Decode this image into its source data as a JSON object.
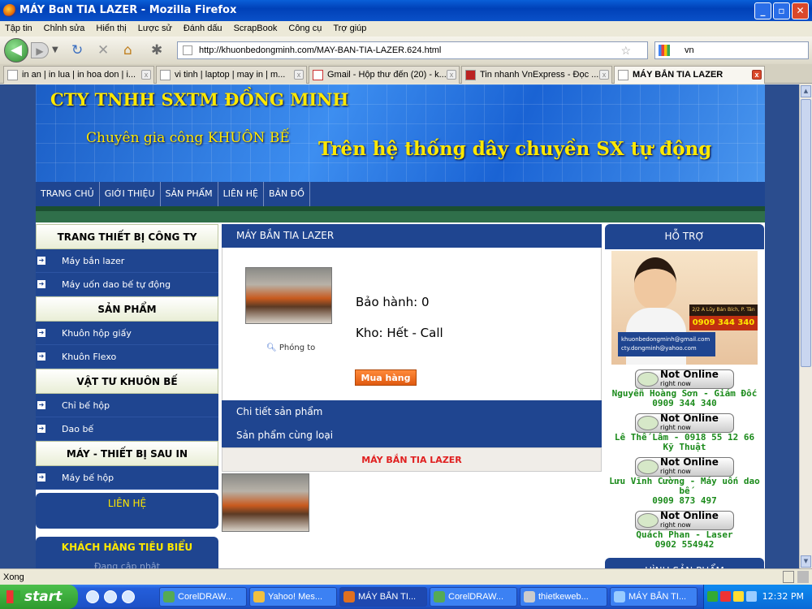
{
  "window": {
    "title": "MÁY BɑN TIA LAZER - Mozilla Firefox"
  },
  "menu": [
    "Tập tin",
    "Chỉnh sửa",
    "Hiển thị",
    "Lược sử",
    "Đánh dấu",
    "ScrapBook",
    "Công cụ",
    "Trợ giúp"
  ],
  "nav": {
    "url": "http://khuonbedongminh.com/MAY-BAN-TIA-LAZER.624.html",
    "search_value": "vn"
  },
  "tabs": [
    {
      "label": "in an | in lua | in hoa don | i..."
    },
    {
      "label": "vi tinh | laptop | may in | m..."
    },
    {
      "label": "Gmail - Hộp thư đến (20) - k..."
    },
    {
      "label": "Tin nhanh VnExpress - Đọc ..."
    },
    {
      "label": "MÁY BẮN TIA LAZER"
    }
  ],
  "banner": {
    "company": "CTY TNHH SXTM ĐỒNG MINH",
    "expert": "Chuyên gia công KHUÔN BẾ",
    "slogan": "Trên hệ thống dây  chuyền SX tự động"
  },
  "main_nav": [
    "TRANG CHỦ",
    "GIỚI THIỆU",
    "SẢN PHẨM",
    "LIÊN HỆ",
    "BẢN ĐỒ"
  ],
  "left": {
    "sections": [
      {
        "title": "TRANG THIẾT BỊ CÔNG TY",
        "items": [
          "Máy bắn lazer",
          "Máy uốn dao bế tự động"
        ]
      },
      {
        "title": "SẢN PHẨM",
        "items": [
          "Khuôn hộp giấy",
          "Khuôn Flexo"
        ]
      },
      {
        "title": "VẬT TƯ KHUÔN BẾ",
        "items": [
          "Chỉ bế hộp",
          "Dao bế"
        ]
      },
      {
        "title": "MÁY - THIẾT BỊ SAU IN",
        "items": [
          "Máy bế hộp"
        ]
      }
    ],
    "contact": "LIÊN HỆ",
    "customers": "KHÁCH HÀNG TIÊU BIỂU",
    "customers_sub": "Đang cập nhật"
  },
  "product": {
    "header": "MÁY BẮN TIA LAZER",
    "zoom": "Phóng to",
    "warranty": "Bảo hành: 0",
    "stock": "Kho: Hết - Call",
    "buy": "Mua hàng",
    "tab_detail": "Chi tiết sản phẩm",
    "tab_related": "Sản phẩm cùng loại",
    "related_title": "MÁY BẮN TIA LAZER"
  },
  "right": {
    "support_title": "HỖ TRỢ",
    "support_address": "2/2 A Lũy Bán Bích, P. Tân Thới Hòa, Q. Tân Phú, HCM",
    "support_phone": "0909 344 340",
    "support_email1": "khuonbedongminh@gmail.com",
    "support_email2": "cty.dongminh@yahoo.com",
    "status_main": "Not Online",
    "status_sub": "right now",
    "contacts": [
      {
        "line1": "Nguyễn Hoàng Sơn - Giám Đốc",
        "line2": "0909 344 340"
      },
      {
        "line1": "Lê Thế Lâm - 0918 55 12 66",
        "line2": "Kỹ Thuật"
      },
      {
        "line1": "Lưu Vĩnh Cường - Máy uốn dao bế",
        "line2": "0909 873 497"
      },
      {
        "line1": "Quách Phan - Laser",
        "line2": "0902 554942"
      }
    ],
    "images_title": "HÌNH SẢN PHẨM"
  },
  "statusbar": {
    "text": "Xong"
  },
  "taskbar": {
    "start": "start",
    "tasks": [
      "CorelDRAW...",
      "Yahoo! Mes...",
      "MÁY BẮN TI...",
      "CorelDRAW...",
      "thietkeweb...",
      "MÁY BẮN TI..."
    ],
    "clock": "12:32 PM"
  }
}
